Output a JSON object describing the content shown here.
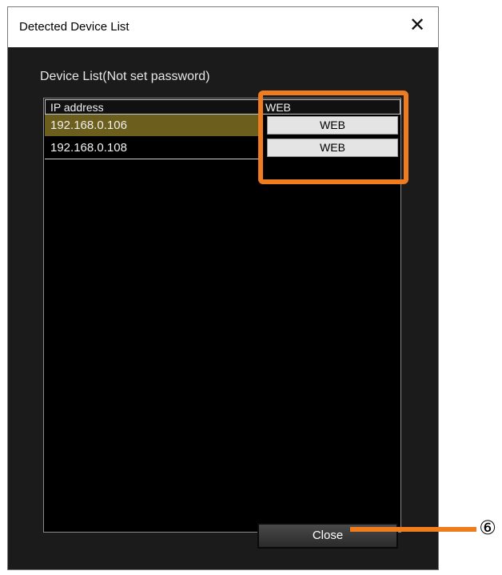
{
  "window": {
    "title": "Detected Device List",
    "close_glyph": "✕"
  },
  "list": {
    "label": "Device List(Not set password)",
    "columns": [
      "IP address",
      "WEB"
    ],
    "rows": [
      {
        "ip": "192.168.0.106",
        "web_label": "WEB",
        "selected": true
      },
      {
        "ip": "192.168.0.108",
        "web_label": "WEB",
        "selected": false
      }
    ]
  },
  "footer": {
    "close_label": "Close"
  },
  "annotation": {
    "callout_number": "⑥"
  },
  "colors": {
    "highlight": "#ef7c1f",
    "selected_row": "#6c5e1c",
    "client_bg": "#1b1b1b"
  }
}
